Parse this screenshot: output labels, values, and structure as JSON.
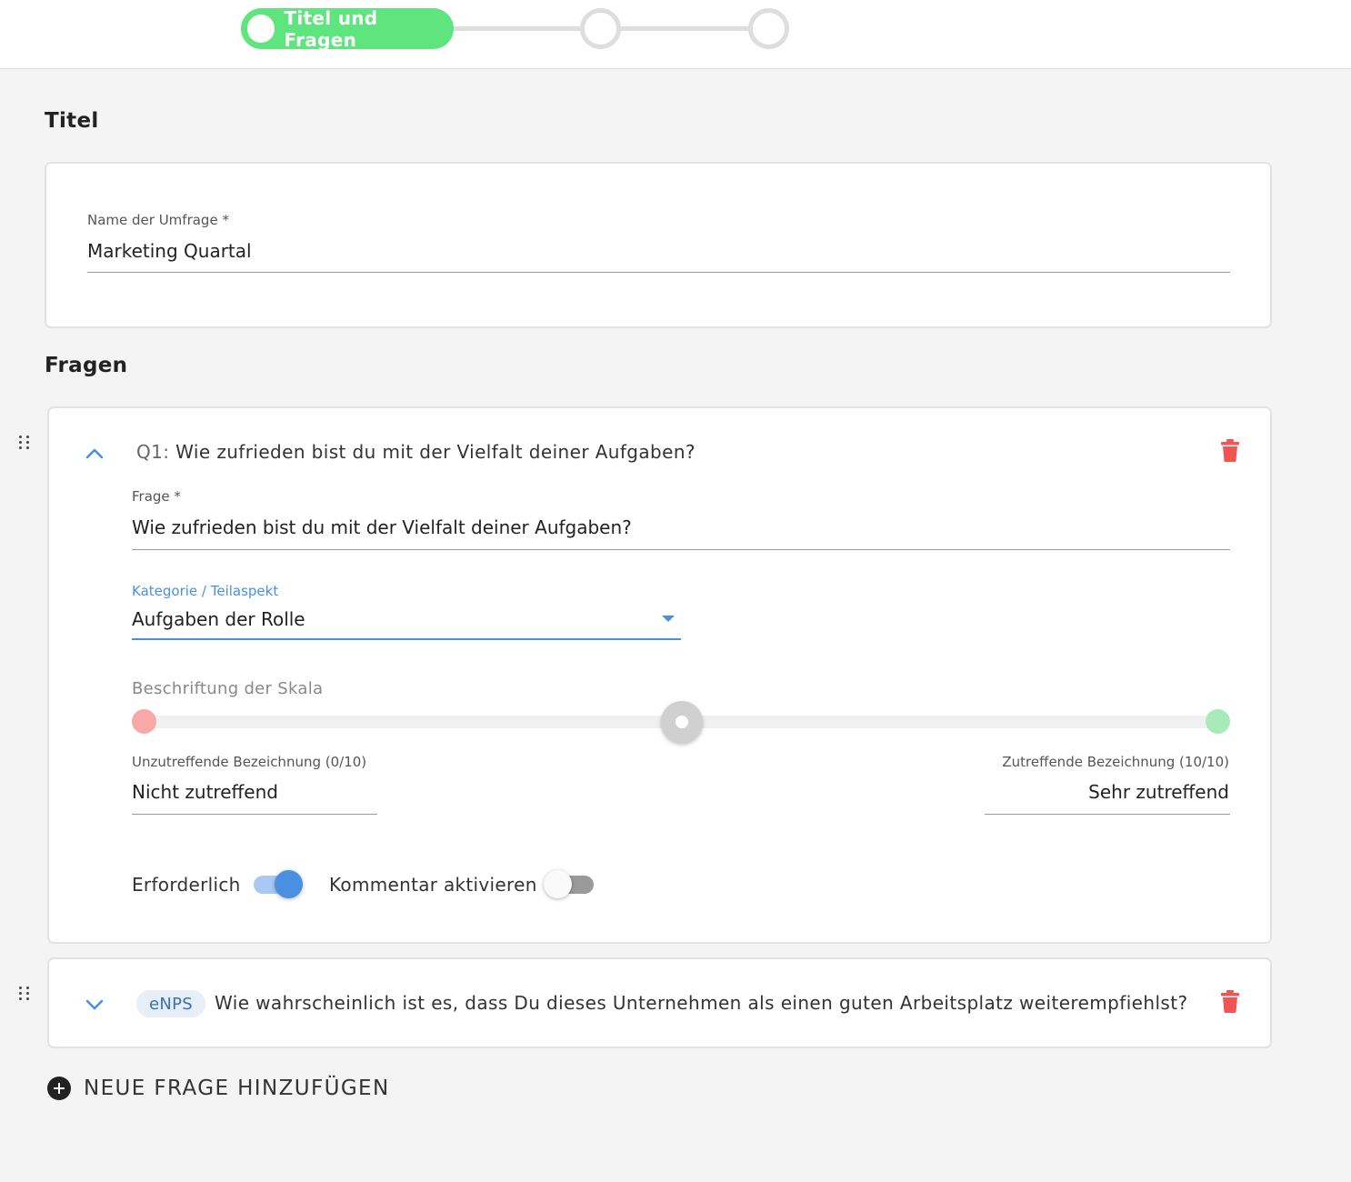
{
  "stepper": {
    "active_step_label": "Titel und Fragen",
    "active_color": "#5fe57e"
  },
  "sections": {
    "title_heading": "Titel",
    "questions_heading": "Fragen"
  },
  "survey": {
    "name_label": "Name der Umfrage *",
    "name_value": "Marketing Quartal"
  },
  "questions": [
    {
      "prefix": "Q1:",
      "title": "Wie zufrieden bist du mit der Vielfalt deiner Aufgaben?",
      "expanded": true,
      "question_label": "Frage *",
      "question_value": "Wie zufrieden bist du mit der Vielfalt deiner Aufgaben?",
      "category_label": "Kategorie / Teilaspekt",
      "category_value": "Aufgaben der Rolle",
      "scale_label": "Beschriftung der Skala",
      "scale_low_color": "#f9a8a8",
      "scale_high_color": "#a8eab8",
      "low_label": "Unzutreffende Bezeichnung (0/10)",
      "low_value": "Nicht zutreffend",
      "high_label": "Zutreffende Bezeichnung (10/10)",
      "high_value": "Sehr zutreffend",
      "required_label": "Erforderlich",
      "required_on": true,
      "comment_label": "Kommentar aktivieren",
      "comment_on": false
    },
    {
      "badge": "eNPS",
      "title": "Wie wahrscheinlich ist es, dass Du dieses Unternehmen als einen guten Arbeitsplatz weiterempfiehlst?",
      "expanded": false
    }
  ],
  "actions": {
    "add_question_label": "NEUE FRAGE HINZUFÜGEN"
  },
  "colors": {
    "accent_blue": "#4a90e2",
    "delete_red": "#f25454"
  }
}
